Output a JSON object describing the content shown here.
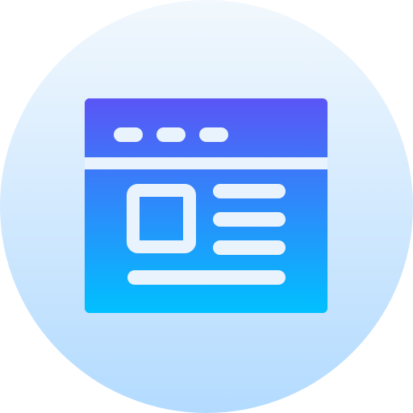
{
  "icon": {
    "name": "web-page-layout-icon",
    "colors": {
      "circle_top": "#f2f8fd",
      "circle_bottom": "#b3dbff",
      "window_top": "#5a55f5",
      "window_bottom": "#00c0ff",
      "line": "#e8f3fd"
    }
  }
}
